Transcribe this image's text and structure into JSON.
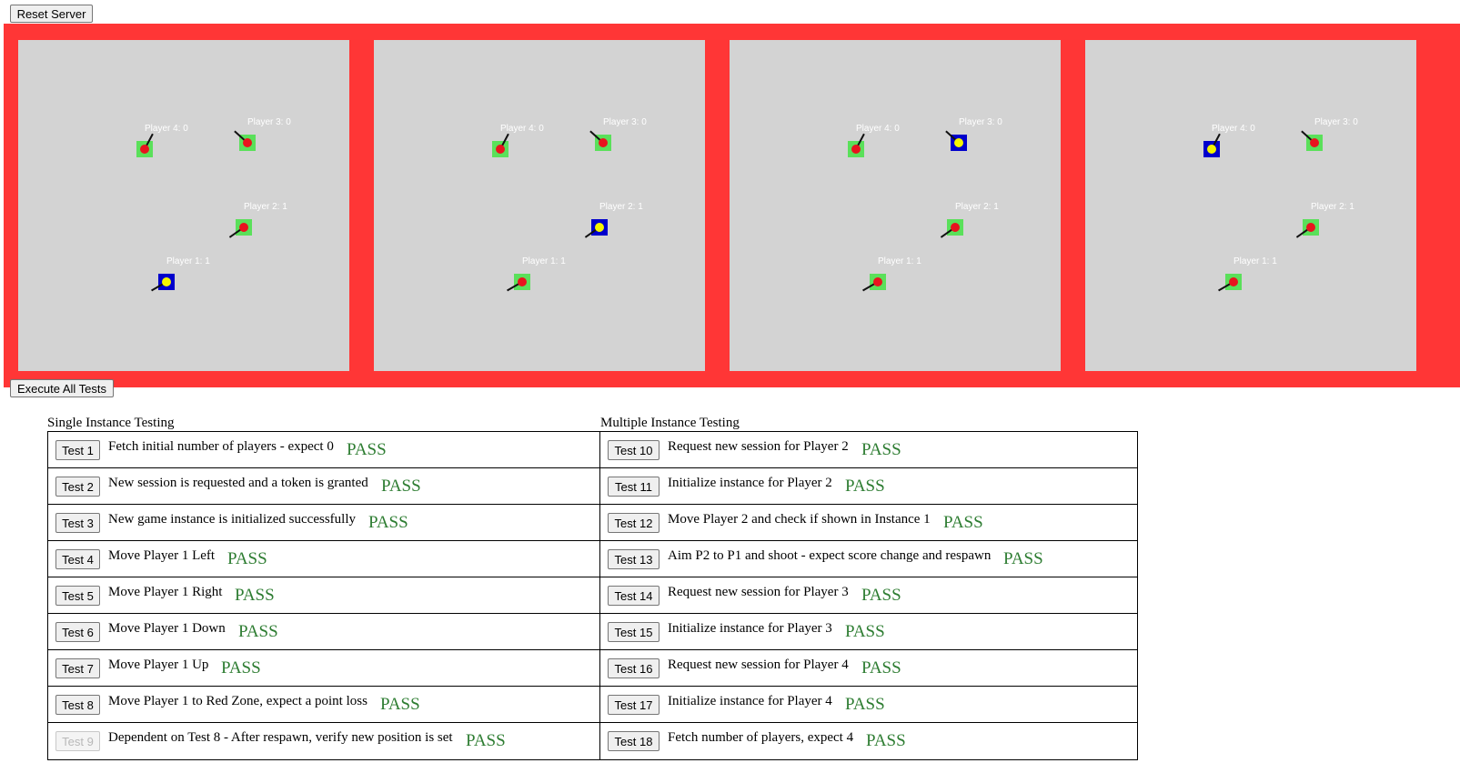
{
  "controls": {
    "reset_label": "Reset Server",
    "execute_label": "Execute All Tests"
  },
  "colors": {
    "arena_red_zone": "#ff3636",
    "instance_background": "#d3d3d3",
    "player_other": "#5ae05a",
    "player_self": "#0000cc",
    "pass_text": "#2e7d32"
  },
  "instances": [
    {
      "players": [
        {
          "label": "Player 4: 0",
          "self": false
        },
        {
          "label": "Player 3: 0",
          "self": false
        },
        {
          "label": "Player 2: 1",
          "self": false
        },
        {
          "label": "Player 1: 1",
          "self": true
        }
      ]
    },
    {
      "players": [
        {
          "label": "Player 4: 0",
          "self": false
        },
        {
          "label": "Player 3: 0",
          "self": false
        },
        {
          "label": "Player 2: 1",
          "self": true
        },
        {
          "label": "Player 1: 1",
          "self": false
        }
      ]
    },
    {
      "players": [
        {
          "label": "Player 4: 0",
          "self": false
        },
        {
          "label": "Player 3: 0",
          "self": true
        },
        {
          "label": "Player 2: 1",
          "self": false
        },
        {
          "label": "Player 1: 1",
          "self": false
        }
      ]
    },
    {
      "players": [
        {
          "label": "Player 4: 0",
          "self": true
        },
        {
          "label": "Player 3: 0",
          "self": false
        },
        {
          "label": "Player 2: 1",
          "self": false
        },
        {
          "label": "Player 1: 1",
          "self": false
        }
      ]
    }
  ],
  "single": {
    "title": "Single Instance Testing",
    "tests": [
      {
        "button": "Test 1",
        "desc": "Fetch initial number of players - expect 0",
        "status": "PASS",
        "disabled": false
      },
      {
        "button": "Test 2",
        "desc": "New session is requested and a token is granted",
        "status": "PASS",
        "disabled": false
      },
      {
        "button": "Test 3",
        "desc": "New game instance is initialized successfully",
        "status": "PASS",
        "disabled": false
      },
      {
        "button": "Test 4",
        "desc": "Move Player 1 Left",
        "status": "PASS",
        "disabled": false
      },
      {
        "button": "Test 5",
        "desc": "Move Player 1 Right",
        "status": "PASS",
        "disabled": false
      },
      {
        "button": "Test 6",
        "desc": "Move Player 1 Down",
        "status": "PASS",
        "disabled": false
      },
      {
        "button": "Test 7",
        "desc": "Move Player 1 Up",
        "status": "PASS",
        "disabled": false
      },
      {
        "button": "Test 8",
        "desc": "Move Player 1 to Red Zone, expect a point loss",
        "status": "PASS",
        "disabled": false
      },
      {
        "button": "Test 9",
        "desc": "Dependent on Test 8 - After respawn, verify new position is set",
        "status": "PASS",
        "disabled": true
      }
    ]
  },
  "multi": {
    "title": "Multiple Instance Testing",
    "tests": [
      {
        "button": "Test 10",
        "desc": "Request new session for Player 2",
        "status": "PASS",
        "disabled": false
      },
      {
        "button": "Test 11",
        "desc": "Initialize instance for Player 2",
        "status": "PASS",
        "disabled": false
      },
      {
        "button": "Test 12",
        "desc": "Move Player 2 and check if shown in Instance 1",
        "status": "PASS",
        "disabled": false
      },
      {
        "button": "Test 13",
        "desc": "Aim P2 to P1 and shoot - expect score change and respawn",
        "status": "PASS",
        "disabled": false
      },
      {
        "button": "Test 14",
        "desc": "Request new session for Player 3",
        "status": "PASS",
        "disabled": false
      },
      {
        "button": "Test 15",
        "desc": "Initialize instance for Player 3",
        "status": "PASS",
        "disabled": false
      },
      {
        "button": "Test 16",
        "desc": "Request new session for Player 4",
        "status": "PASS",
        "disabled": false
      },
      {
        "button": "Test 17",
        "desc": "Initialize instance for Player 4",
        "status": "PASS",
        "disabled": false
      },
      {
        "button": "Test 18",
        "desc": "Fetch number of players, expect 4",
        "status": "PASS",
        "disabled": false
      }
    ]
  }
}
